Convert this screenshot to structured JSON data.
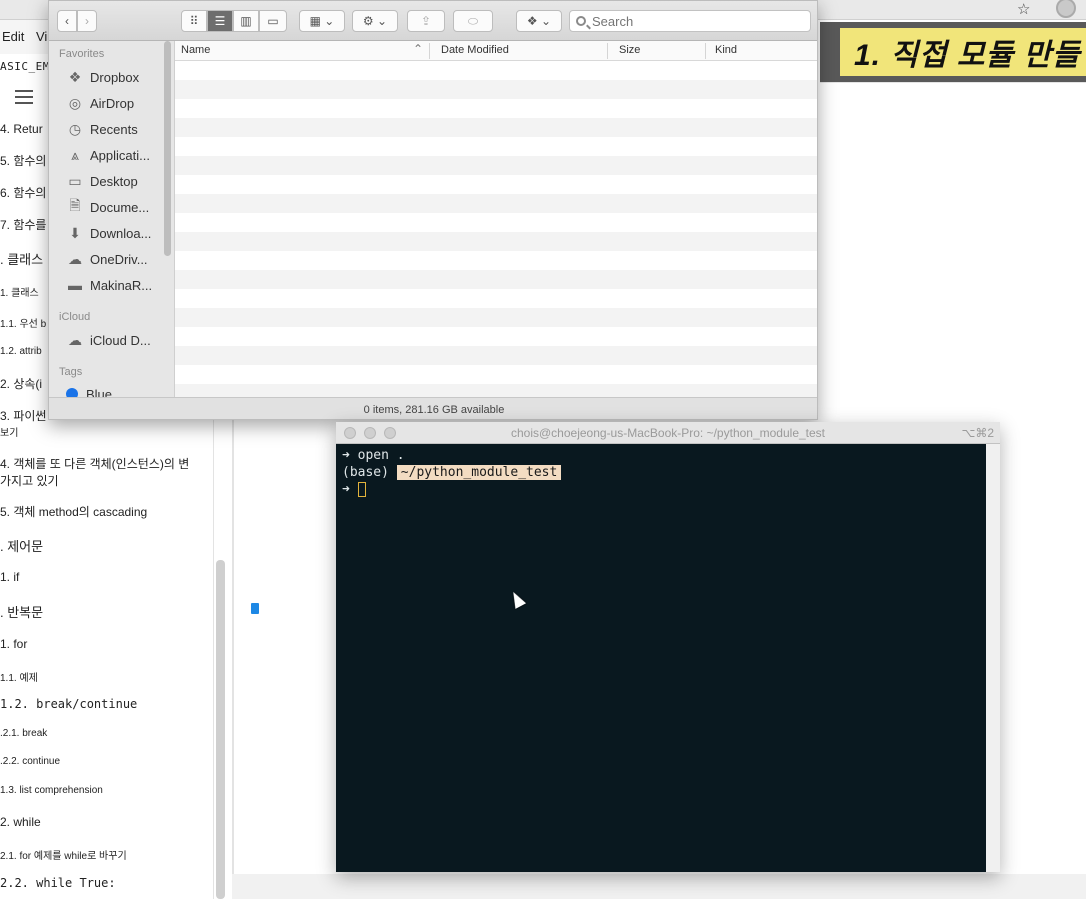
{
  "browser": {
    "menu": [
      "Edit",
      "Vi"
    ],
    "doc_code": "ASIC_EM",
    "star_icon": "star-icon",
    "banner_text": "1. 직접 모듈 만들"
  },
  "toc": [
    {
      "text": "4. Retur",
      "level": "h2"
    },
    {
      "text": "5. 함수의",
      "level": "h2"
    },
    {
      "text": "6. 함수의",
      "level": "h2"
    },
    {
      "text": "7. 함수를",
      "level": "h2"
    },
    {
      "text": ". 클래스",
      "level": "h1"
    },
    {
      "text": "1. 클래스",
      "level": "h2"
    },
    {
      "text": "1.1. 우선 b",
      "level": "h3"
    },
    {
      "text": "1.2. attrib",
      "level": "h3"
    },
    {
      "text": "2. 상속(i",
      "level": "h2"
    },
    {
      "text": "3. 파이썬",
      "level": "h2"
    },
    {
      "text": "보기",
      "level": "h2"
    },
    {
      "text": "4. 객체를 또 다른 객체(인스턴스)의 변",
      "level": "h2"
    },
    {
      "text": "가지고 있기",
      "level": "h2"
    },
    {
      "text": "5. 객체 method의 cascading",
      "level": "h2"
    },
    {
      "text": ". 제어문",
      "level": "h1"
    },
    {
      "text": "1. if",
      "level": "h2"
    },
    {
      "text": ". 반복문",
      "level": "h1"
    },
    {
      "text": "1. for",
      "level": "h2"
    },
    {
      "text": "1.1. 예제",
      "level": "h3"
    },
    {
      "text": "1.2. break/continue",
      "level": "h2"
    },
    {
      "text": ".2.1. break",
      "level": "h3"
    },
    {
      "text": ".2.2. continue",
      "level": "h3"
    },
    {
      "text": "1.3. list comprehension",
      "level": "h3"
    },
    {
      "text": "2. while",
      "level": "h2"
    },
    {
      "text": "2.1. for 예제를 while로 바꾸기",
      "level": "h3"
    },
    {
      "text": "2.2. while True:",
      "level": "h2"
    }
  ],
  "finder": {
    "search_placeholder": "Search",
    "sidebar": {
      "favorites_heading": "Favorites",
      "favorites": [
        {
          "label": "Dropbox",
          "icon": "dropbox-icon"
        },
        {
          "label": "AirDrop",
          "icon": "airdrop-icon"
        },
        {
          "label": "Recents",
          "icon": "clock-icon"
        },
        {
          "label": "Applicati...",
          "icon": "applications-icon"
        },
        {
          "label": "Desktop",
          "icon": "desktop-icon"
        },
        {
          "label": "Docume...",
          "icon": "document-icon"
        },
        {
          "label": "Downloa...",
          "icon": "download-icon"
        },
        {
          "label": "OneDriv...",
          "icon": "cloud-icon"
        },
        {
          "label": "MakinaR...",
          "icon": "folder-icon"
        }
      ],
      "icloud_heading": "iCloud",
      "icloud": [
        {
          "label": "iCloud D...",
          "icon": "cloud-icon"
        }
      ],
      "tags_heading": "Tags",
      "tags": [
        {
          "label": "Blue",
          "color": "#1a73e8"
        }
      ]
    },
    "columns": {
      "name": "Name",
      "date": "Date Modified",
      "size": "Size",
      "kind": "Kind"
    },
    "status": "0 items, 281.16 GB available"
  },
  "terminal": {
    "title": "chois@choejeong-us-MacBook-Pro: ~/python_module_test",
    "shortcut": "⌥⌘2",
    "line1": "➜ open .",
    "env": "(base)",
    "path": "~/python_module_test",
    "prompt": "➜"
  }
}
